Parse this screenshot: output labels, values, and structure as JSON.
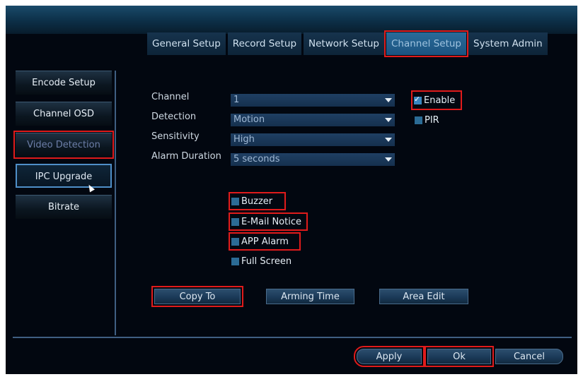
{
  "tabs": [
    "General Setup",
    "Record Setup",
    "Network Setup",
    "Channel Setup",
    "System Admin"
  ],
  "sidebar": {
    "items": [
      "Encode Setup",
      "Channel OSD",
      "Video Detection",
      "IPC Upgrade",
      "Bitrate"
    ]
  },
  "form": {
    "channel_label": "Channel",
    "channel_value": "1",
    "detection_label": "Detection",
    "detection_value": "Motion",
    "sensitivity_label": "Sensitivity",
    "sensitivity_value": "High",
    "alarm_duration_label": "Alarm Duration",
    "alarm_duration_value": "5 seconds"
  },
  "options": {
    "enable": "Enable",
    "pir": "PIR",
    "buzzer": "Buzzer",
    "email": "E-Mail Notice",
    "app_alarm": "APP Alarm",
    "full_screen": "Full Screen"
  },
  "states": {
    "enable": true,
    "pir": false,
    "buzzer": false,
    "email": false,
    "app_alarm": false,
    "full_screen": false
  },
  "buttons": {
    "copy_to": "Copy To",
    "arming_time": "Arming Time",
    "area_edit": "Area Edit",
    "apply": "Apply",
    "ok": "Ok",
    "cancel": "Cancel"
  },
  "colors": {
    "highlight": "#e01b1b",
    "accent": "#2a6b99"
  }
}
